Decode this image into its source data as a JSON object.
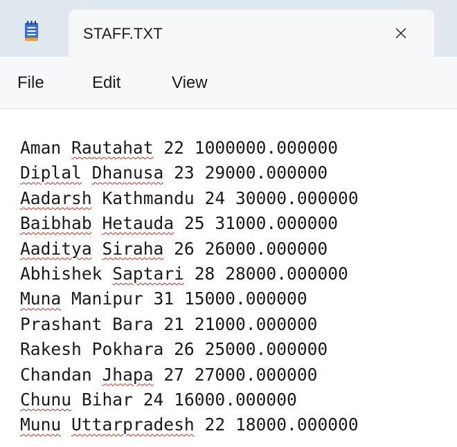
{
  "tab": {
    "title": "STAFF.TXT",
    "app_icon": "notepad-icon",
    "close_icon": "close-icon"
  },
  "menu": {
    "file": "File",
    "edit": "Edit",
    "view": "View"
  },
  "colors": {
    "titlebar": "#dfe7ef",
    "tab": "#f6f8fa",
    "spellcheck": "#c42b1c",
    "icon_blue": "#3b6fd4"
  },
  "lines": [
    {
      "name": "Aman",
      "place": "Rautahat",
      "age": "22",
      "salary": "1000000.000000",
      "sq_name": false,
      "sq_place": true
    },
    {
      "name": "Diplal",
      "place": "Dhanusa",
      "age": "23",
      "salary": "29000.000000",
      "sq_name": true,
      "sq_place": true
    },
    {
      "name": "Aadarsh",
      "place": "Kathmandu",
      "age": "24",
      "salary": "30000.000000",
      "sq_name": true,
      "sq_place": false
    },
    {
      "name": "Baibhab",
      "place": "Hetauda",
      "age": "25",
      "salary": "31000.000000",
      "sq_name": true,
      "sq_place": true
    },
    {
      "name": "Aaditya",
      "place": "Siraha",
      "age": "26",
      "salary": "26000.000000",
      "sq_name": true,
      "sq_place": true
    },
    {
      "name": "Abhishek",
      "place": "Saptari",
      "age": "28",
      "salary": "28000.000000",
      "sq_name": false,
      "sq_place": true
    },
    {
      "name": "Muna",
      "place": "Manipur",
      "age": "31",
      "salary": "15000.000000",
      "sq_name": true,
      "sq_place": false
    },
    {
      "name": "Prashant",
      "place": "Bara",
      "age": "21",
      "salary": "21000.000000",
      "sq_name": false,
      "sq_place": false
    },
    {
      "name": "Rakesh",
      "place": "Pokhara",
      "age": "26",
      "salary": "25000.000000",
      "sq_name": false,
      "sq_place": false
    },
    {
      "name": "Chandan",
      "place": "Jhapa",
      "age": "27",
      "salary": "27000.000000",
      "sq_name": false,
      "sq_place": true
    },
    {
      "name": "Chunu",
      "place": "Bihar",
      "age": "24",
      "salary": "16000.000000",
      "sq_name": true,
      "sq_place": false
    },
    {
      "name": "Munu",
      "place": "Uttarpradesh",
      "age": "22",
      "salary": "18000.000000",
      "sq_name": true,
      "sq_place": true
    }
  ]
}
